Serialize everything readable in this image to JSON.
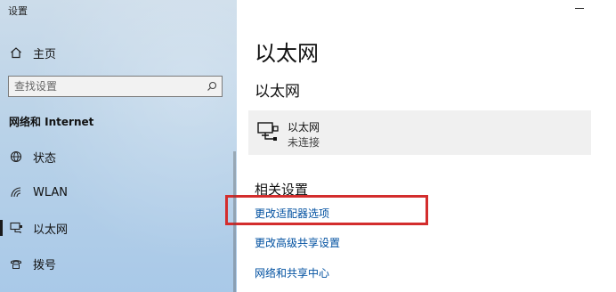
{
  "window": {
    "title": "设置"
  },
  "sidebar": {
    "home_label": "主页",
    "search_placeholder": "查找设置",
    "section_label": "网络和 Internet",
    "items": [
      {
        "label": "状态",
        "icon": "globe-status-icon"
      },
      {
        "label": "WLAN",
        "icon": "wifi-icon"
      },
      {
        "label": "以太网",
        "icon": "ethernet-icon"
      },
      {
        "label": "拨号",
        "icon": "dialup-icon"
      }
    ]
  },
  "main": {
    "page_title": "以太网",
    "section_title": "以太网",
    "connection": {
      "name": "以太网",
      "status": "未连接",
      "icon": "network-computer-icon"
    },
    "related_title": "相关设置",
    "links": [
      {
        "label": "更改适配器选项"
      },
      {
        "label": "更改高级共享设置"
      },
      {
        "label": "网络和共享中心"
      }
    ]
  },
  "annotation": {
    "highlight_color": "#d32d2d",
    "highlights": "更改适配器选项"
  },
  "colors": {
    "link": "#0050a0",
    "sidebar_bg": "#b9d2e8",
    "card_bg": "#f0f0f0"
  }
}
